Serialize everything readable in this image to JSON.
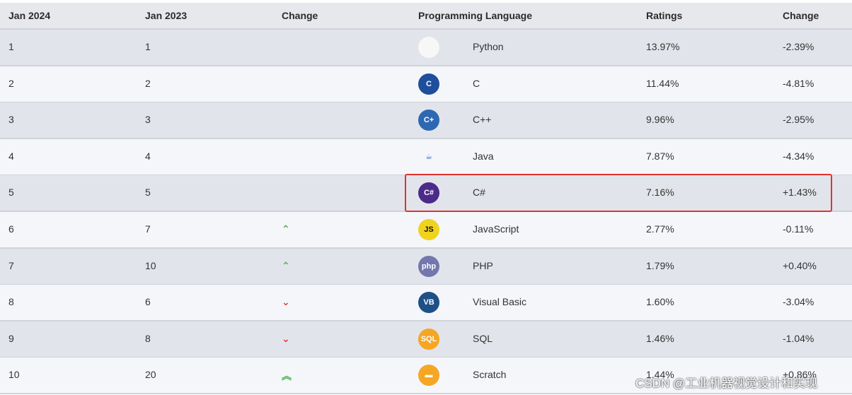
{
  "headers": {
    "jan2024": "Jan 2024",
    "jan2023": "Jan 2023",
    "change": "Change",
    "language": "Programming Language",
    "ratings": "Ratings",
    "ratings_change": "Change"
  },
  "rows": [
    {
      "jan2024": "1",
      "jan2023": "1",
      "trend": "",
      "logo_text": "",
      "logo_icon": "python-icon",
      "logo_color": "#f7f7f7",
      "language": "Python",
      "rating": "13.97%",
      "change": "-2.39%"
    },
    {
      "jan2024": "2",
      "jan2023": "2",
      "trend": "",
      "logo_text": "C",
      "logo_icon": "c-icon",
      "logo_color": "#1f4e9c",
      "language": "C",
      "rating": "11.44%",
      "change": "-4.81%"
    },
    {
      "jan2024": "3",
      "jan2023": "3",
      "trend": "",
      "logo_text": "C+",
      "logo_icon": "cpp-icon",
      "logo_color": "#2e68b3",
      "language": "C++",
      "rating": "9.96%",
      "change": "-2.95%"
    },
    {
      "jan2024": "4",
      "jan2023": "4",
      "trend": "",
      "logo_text": "☕",
      "logo_icon": "java-icon",
      "logo_color": "#f4f6fa",
      "language": "Java",
      "rating": "7.87%",
      "change": "-4.34%"
    },
    {
      "jan2024": "5",
      "jan2023": "5",
      "trend": "",
      "logo_text": "C#",
      "logo_icon": "csharp-icon",
      "logo_color": "#4b2a8a",
      "language": "C#",
      "rating": "7.16%",
      "change": "+1.43%"
    },
    {
      "jan2024": "6",
      "jan2023": "7",
      "trend": "^",
      "logo_text": "JS",
      "logo_icon": "javascript-icon",
      "logo_color": "#f0d31d",
      "language": "JavaScript",
      "rating": "2.77%",
      "change": "-0.11%"
    },
    {
      "jan2024": "7",
      "jan2023": "10",
      "trend": "^",
      "logo_text": "php",
      "logo_icon": "php-icon",
      "logo_color": "#7377ad",
      "language": "PHP",
      "rating": "1.79%",
      "change": "+0.40%"
    },
    {
      "jan2024": "8",
      "jan2023": "6",
      "trend": "v",
      "logo_text": "VB",
      "logo_icon": "visual-basic-icon",
      "logo_color": "#1e4f87",
      "language": "Visual Basic",
      "rating": "1.60%",
      "change": "-3.04%"
    },
    {
      "jan2024": "9",
      "jan2023": "8",
      "trend": "v",
      "logo_text": "SQL",
      "logo_icon": "sql-icon",
      "logo_color": "#f5a623",
      "language": "SQL",
      "rating": "1.46%",
      "change": "-1.04%"
    },
    {
      "jan2024": "10",
      "jan2023": "20",
      "trend": "^^",
      "logo_text": "▬",
      "logo_icon": "scratch-icon",
      "logo_color": "#f5a623",
      "language": "Scratch",
      "rating": "1.44%",
      "change": "+0.86%"
    }
  ],
  "watermark": "CSDN @工业机器视觉设计和实现"
}
